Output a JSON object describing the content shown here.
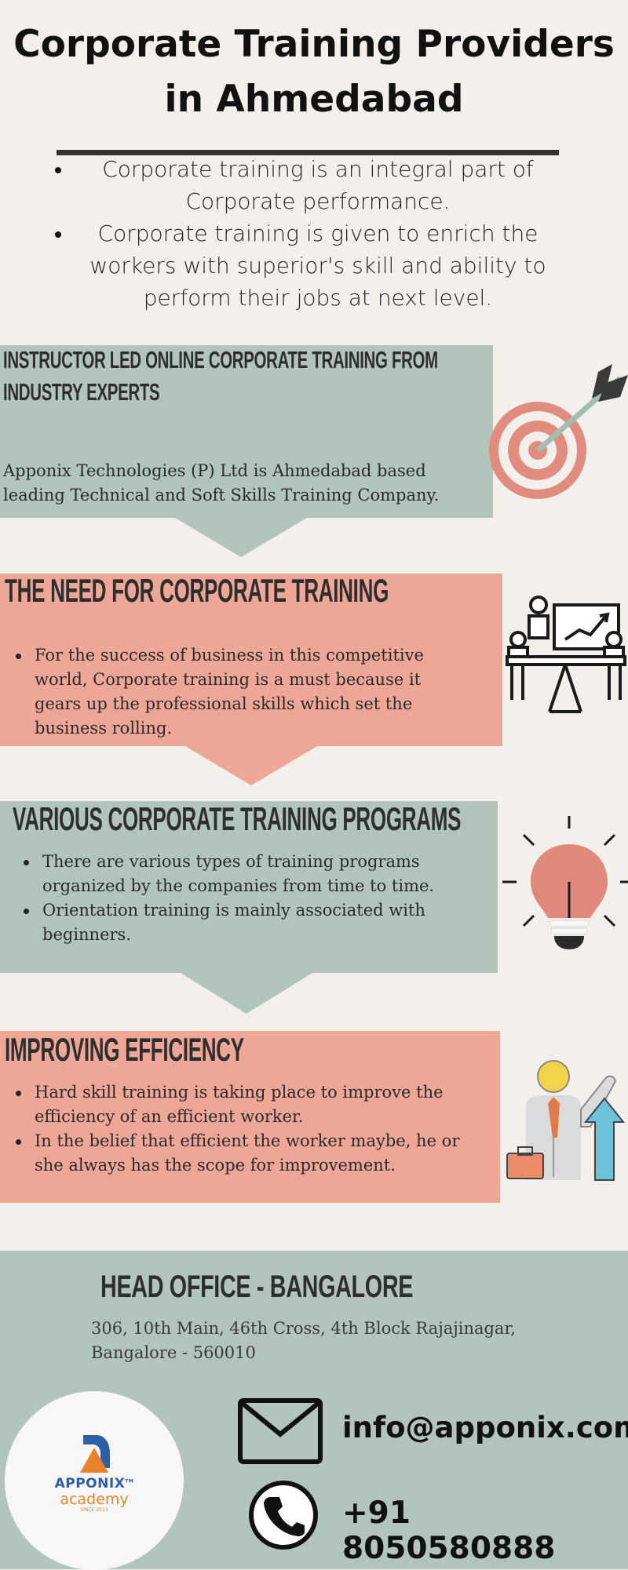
{
  "title": {
    "line1": "Corporate Training Providers",
    "line2": "in Ahmedabad"
  },
  "intro": {
    "bullets": [
      "Corporate training is an integral part of Corporate performance.",
      "Corporate training is given to enrich the workers with superior's skill and ability to perform their jobs at next level."
    ]
  },
  "sections": [
    {
      "heading": [
        "INSTRUCTOR LED ONLINE CORPORATE TRAINING FROM",
        "INDUSTRY EXPERTS"
      ],
      "body": "Apponix Technologies (P) Ltd is Ahmedabad based leading Technical and Soft Skills Training Company.",
      "icon": "target-icon"
    },
    {
      "heading": [
        "THE NEED FOR CORPORATE TRAINING"
      ],
      "bullets": [
        " For the success of business in this competitive world, Corporate training is a must because it gears up the professional skills which set the business rolling."
      ],
      "icon": "meeting-presentation-icon"
    },
    {
      "heading": [
        "VARIOUS CORPORATE TRAINING PROGRAMS"
      ],
      "bullets": [
        "There are various types of training programs organized by the companies from time to time.",
        "Orientation training is mainly associated with beginners."
      ],
      "icon": "lightbulb-icon"
    },
    {
      "heading": [
        "IMPROVING EFFICIENCY"
      ],
      "bullets": [
        "Hard skill training is taking place to improve the efficiency of an efficient worker.",
        " In the belief that efficient the worker maybe, he or she always has the scope for improvement."
      ],
      "icon": "businessman-growth-icon"
    }
  ],
  "footer": {
    "office_heading": "HEAD OFFICE - BANGALORE",
    "address_line1": "306, 10th Main, 46th Cross, 4th Block Rajajinagar,",
    "address_line2": "Bangalore - 560010",
    "email": "info@apponix.com",
    "phone": "+91 8050580888",
    "logo": {
      "name": "APPONIX",
      "tm": "TM",
      "sub": "academy",
      "since": "SINCE 2013"
    }
  },
  "colors": {
    "background": "#f3efea",
    "green_panel": "#b2c5bc",
    "salmon_panel": "#eea697",
    "accent_orange": "#e8832a",
    "accent_blue": "#2e5fa3"
  }
}
